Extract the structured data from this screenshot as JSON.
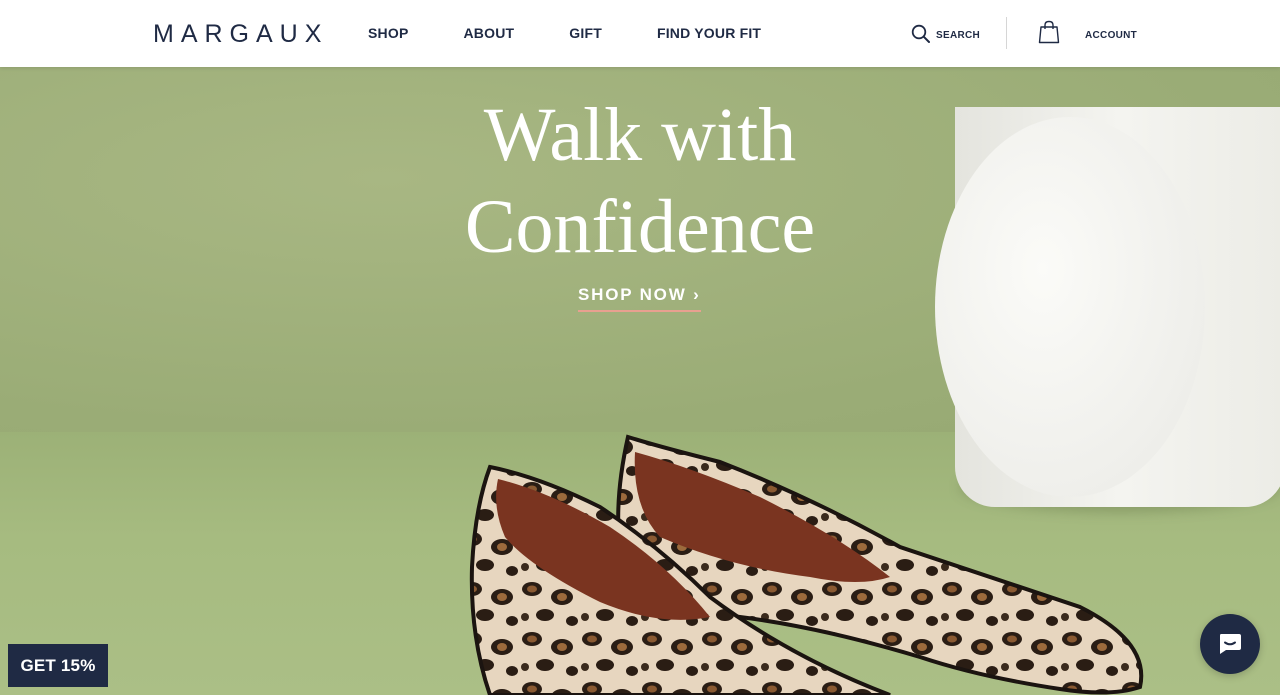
{
  "header": {
    "logo": "MARGAUX",
    "nav": [
      "SHOP",
      "ABOUT",
      "GIFT",
      "FIND YOUR FIT"
    ],
    "search_label": "SEARCH",
    "account_label": "ACCOUNT"
  },
  "hero": {
    "headline_line1": "Walk with",
    "headline_line2": "Confidence",
    "cta_label": "SHOP NOW",
    "cta_arrow": "›"
  },
  "promo": {
    "label": "GET 15%"
  },
  "chat": {
    "icon": "chat-icon"
  },
  "colors": {
    "brand_navy": "#1f2a44",
    "hero_green": "#a2b27c",
    "cta_underline": "#e8a090"
  }
}
